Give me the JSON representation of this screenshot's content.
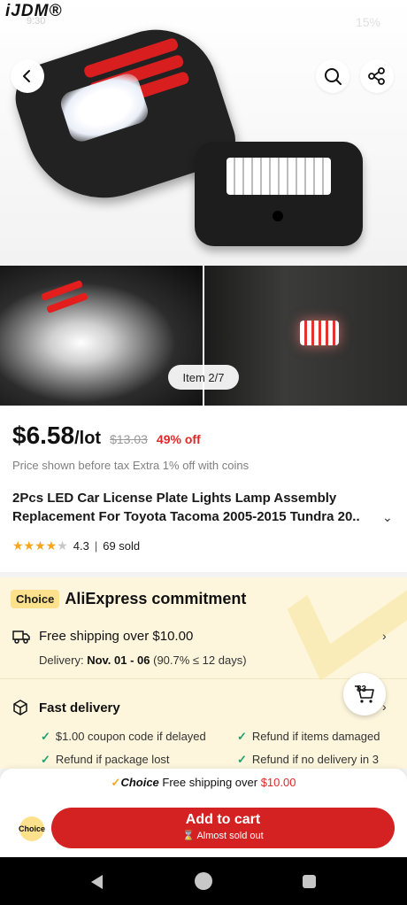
{
  "statusbar": {
    "watermark": "iJDM®",
    "time": "9:30",
    "battery": "15%",
    "icons": [
      "wifi-icon",
      "signal-icon",
      "battery-icon"
    ]
  },
  "gallery": {
    "item_indicator": "Item 2/7",
    "images": [
      "led-lamp-hero-image",
      "lamp-lit-thumbnail",
      "lamp-installed-thumbnail"
    ]
  },
  "product": {
    "price": "$6.58",
    "unit": "/lot",
    "old_price": "$13.03",
    "discount": "49% off",
    "tax_note": "Price shown before tax Extra 1% off with coins",
    "title": "2Pcs LED Car License Plate Lights Lamp Assembly Replacement For Toyota Tacoma 2005-2015 Tundra 20..",
    "rating": "4.3",
    "sold": "69 sold",
    "stars_filled": 4.3
  },
  "commitment": {
    "badge": "Choice",
    "title": "AliExpress commitment",
    "shipping_label": "Free shipping over $10.00",
    "delivery_prefix": "Delivery:",
    "delivery_dates": "Nov. 01 - 06",
    "delivery_rate": "(90.7% ≤ 12 days)",
    "fast_delivery": "Fast delivery",
    "perks": [
      "$1.00 coupon code if delayed",
      "Refund if items damaged",
      "Refund if package lost",
      "Refund if no delivery in 3"
    ]
  },
  "cart_bubble": {
    "count": "83"
  },
  "bottom_bar": {
    "promo_choice": "Choice",
    "promo_text": "Free shipping over",
    "promo_amount": "$10.00",
    "choice_badge": "Choice",
    "add_to_cart": "Add to cart",
    "stock_note": "Almost sold out"
  },
  "colors": {
    "accent_red": "#d42222",
    "choice_yellow": "#fde18c",
    "commit_bg": "#fdf6dd",
    "check_green": "#21a06b",
    "star_orange": "#f7a51b"
  }
}
